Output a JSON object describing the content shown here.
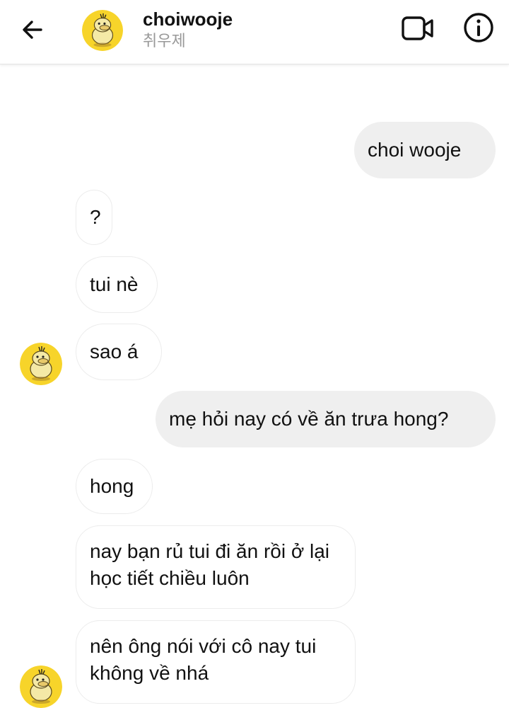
{
  "header": {
    "username": "choiwooje",
    "display_name": "취우제",
    "back_icon": "arrow-left-icon",
    "video_icon": "video-camera-icon",
    "info_icon": "info-icon",
    "avatar_color": "#f7d42a"
  },
  "messages": [
    {
      "sender": "me",
      "text": "choi wooje"
    },
    {
      "sender": "them",
      "text": "?"
    },
    {
      "sender": "them",
      "text": "tui nè"
    },
    {
      "sender": "them",
      "text": "sao á"
    },
    {
      "sender": "me",
      "text": "mẹ hỏi nay có về ăn trưa hong?"
    },
    {
      "sender": "them",
      "text": "hong"
    },
    {
      "sender": "them",
      "text": "nay bạn rủ tui đi ăn rồi ở lại học tiết chiều luôn"
    },
    {
      "sender": "them",
      "text": "nên ông nói với cô nay tui không về nhá"
    }
  ],
  "colors": {
    "outgoing_bubble": "#efefef",
    "incoming_bubble": "#ffffff",
    "incoming_border": "#ececec",
    "subtitle": "#999999"
  }
}
